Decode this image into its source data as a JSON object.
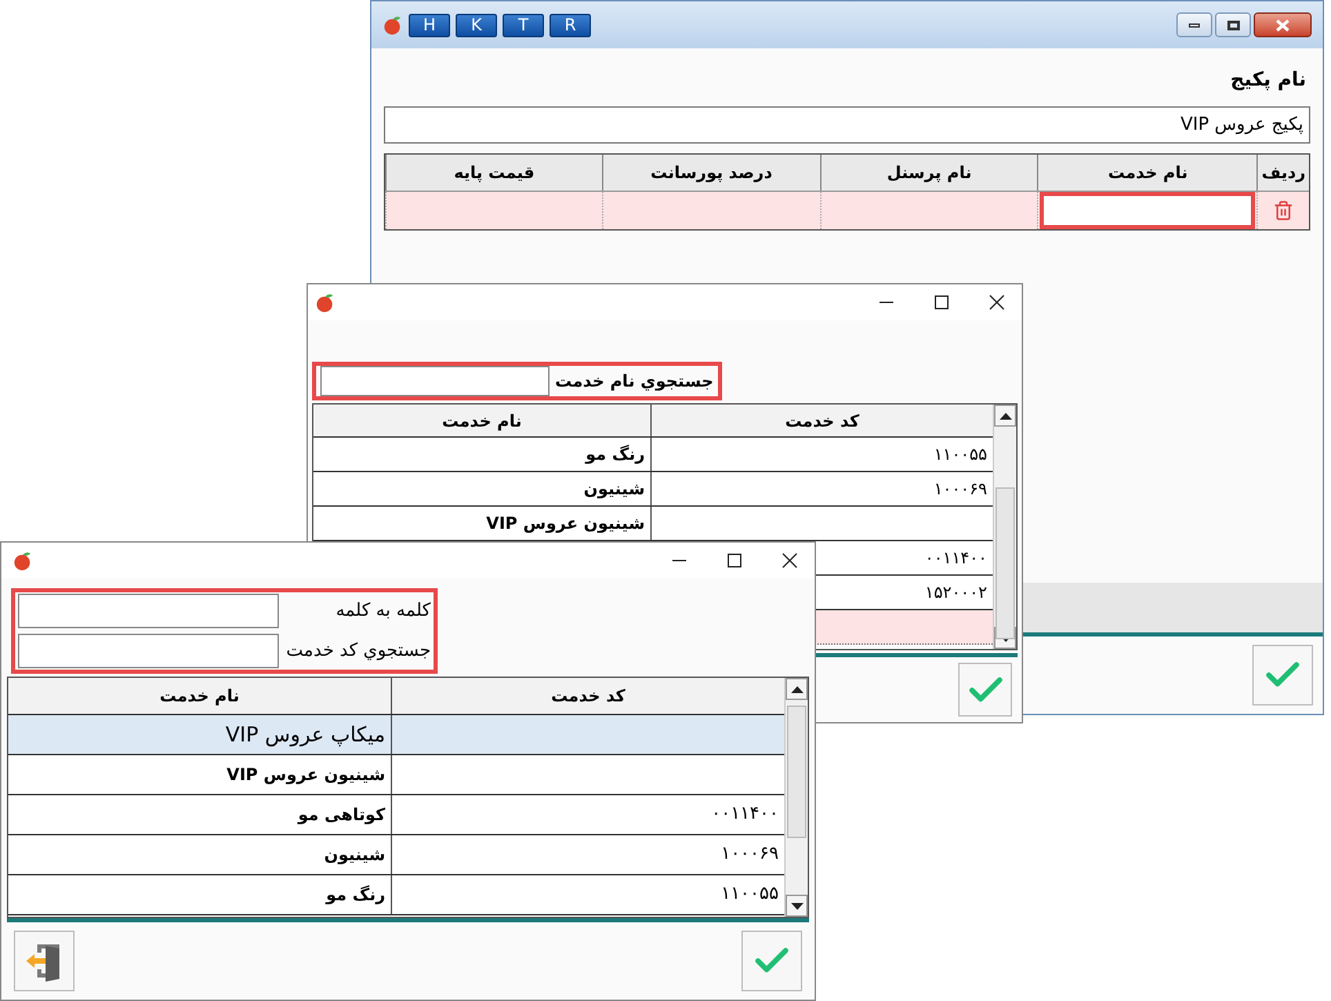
{
  "main_window": {
    "title_buttons": [
      "R",
      "T",
      "K",
      "H"
    ],
    "package_label": "نام پکیج",
    "package_name": "پکیج عروس VIP",
    "table": {
      "columns": [
        "ردیف",
        "نام خدمت",
        "نام پرسنل",
        "درصد پورسانت",
        "قیمت پایه"
      ],
      "rows": [
        {
          "highlighted": true
        }
      ]
    }
  },
  "service_search_window": {
    "search_label": "جستجوي نام خدمت",
    "search_highlighted": true,
    "columns": [
      "کد خدمت",
      "نام خدمت"
    ],
    "rows": [
      {
        "kind": "item",
        "name": "رنگ مو",
        "code": "۱۱۰۰۵۵"
      },
      {
        "kind": "item",
        "name": "شینیون",
        "code": "۱۰۰۰۶۹"
      },
      {
        "kind": "item",
        "name": "شینیون عروس VIP"
      },
      {
        "kind": "item",
        "code": "۰۰۱۱۴۰۰"
      },
      {
        "kind": "item",
        "code": "۱۵۲۰۰۰۲"
      },
      {
        "kind": "new"
      }
    ]
  },
  "service_list_window": {
    "search_highlighted": true,
    "fields": [
      {
        "label": "کلمه به کلمه"
      },
      {
        "label": "جستجوي کد خدمت"
      }
    ],
    "columns": [
      "کد خدمت",
      "نام خدمت"
    ],
    "rows": [
      {
        "name": "میکاپ عروس VIP",
        "selected": true
      },
      {
        "name": "شینیون عروس VIP",
        "selected": false
      },
      {
        "name": "کوتاهی مو",
        "code": "۰۰۱۱۴۰۰",
        "selected": false
      },
      {
        "name": "شینیون",
        "code": "۱۰۰۰۶۹",
        "selected": false
      },
      {
        "name": "رنگ مو",
        "code": "۱۱۰۰۵۵",
        "selected": false
      }
    ]
  }
}
